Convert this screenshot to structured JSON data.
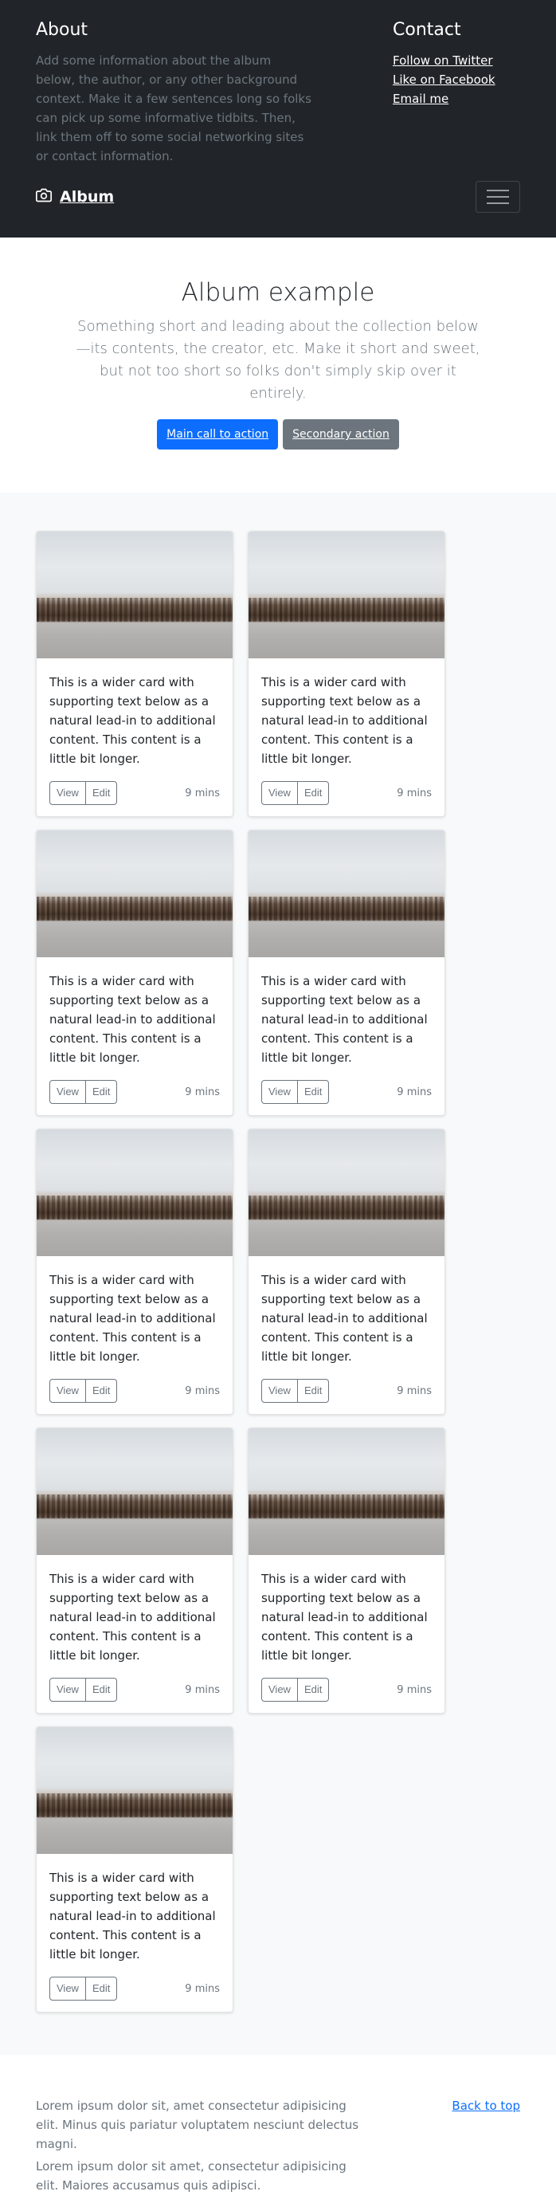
{
  "about": {
    "title": "About",
    "text": "Add some information about the album below, the author, or any other background context. Make it a few sentences long so folks can pick up some informative tidbits. Then, link them off to some social networking sites or contact information."
  },
  "contact": {
    "title": "Contact",
    "links": [
      "Follow on Twitter",
      "Like on Facebook",
      "Email me"
    ]
  },
  "navbar": {
    "brand": "Album"
  },
  "hero": {
    "title": "Album example",
    "lead": "Something short and leading about the collection below—its contents, the creator, etc. Make it short and sweet, but not too short so folks don't simply skip over it entirely.",
    "primary": "Main call to action",
    "secondary": "Secondary action"
  },
  "cards": [
    {
      "text": "This is a wider card with supporting text below as a natural lead-in to additional content. This content is a little bit longer.",
      "view": "View",
      "edit": "Edit",
      "time": "9 mins"
    },
    {
      "text": "This is a wider card with supporting text below as a natural lead-in to additional content. This content is a little bit longer.",
      "view": "View",
      "edit": "Edit",
      "time": "9 mins"
    },
    {
      "text": "This is a wider card with supporting text below as a natural lead-in to additional content. This content is a little bit longer.",
      "view": "View",
      "edit": "Edit",
      "time": "9 mins"
    },
    {
      "text": "This is a wider card with supporting text below as a natural lead-in to additional content. This content is a little bit longer.",
      "view": "View",
      "edit": "Edit",
      "time": "9 mins"
    },
    {
      "text": "This is a wider card with supporting text below as a natural lead-in to additional content. This content is a little bit longer.",
      "view": "View",
      "edit": "Edit",
      "time": "9 mins"
    },
    {
      "text": "This is a wider card with supporting text below as a natural lead-in to additional content. This content is a little bit longer.",
      "view": "View",
      "edit": "Edit",
      "time": "9 mins"
    },
    {
      "text": "This is a wider card with supporting text below as a natural lead-in to additional content. This content is a little bit longer.",
      "view": "View",
      "edit": "Edit",
      "time": "9 mins"
    },
    {
      "text": "This is a wider card with supporting text below as a natural lead-in to additional content. This content is a little bit longer.",
      "view": "View",
      "edit": "Edit",
      "time": "9 mins"
    },
    {
      "text": "This is a wider card with supporting text below as a natural lead-in to additional content. This content is a little bit longer.",
      "view": "View",
      "edit": "Edit",
      "time": "9 mins"
    }
  ],
  "footer": {
    "back_to_top": "Back to top",
    "line1": "Lorem ipsum dolor sit, amet consectetur adipisicing elit. Minus quis pariatur voluptatem nesciunt delectus magni.",
    "line2": "Lorem ipsum dolor sit amet, consectetur adipisicing elit. Maiores accusamus quis adipisci."
  },
  "colors": {
    "dark": "#212529",
    "primary": "#0d6efd",
    "secondary": "#6c757d",
    "light_bg": "#f8f9fa"
  },
  "icons": [
    "camera-icon",
    "hamburger-menu-icon"
  ]
}
